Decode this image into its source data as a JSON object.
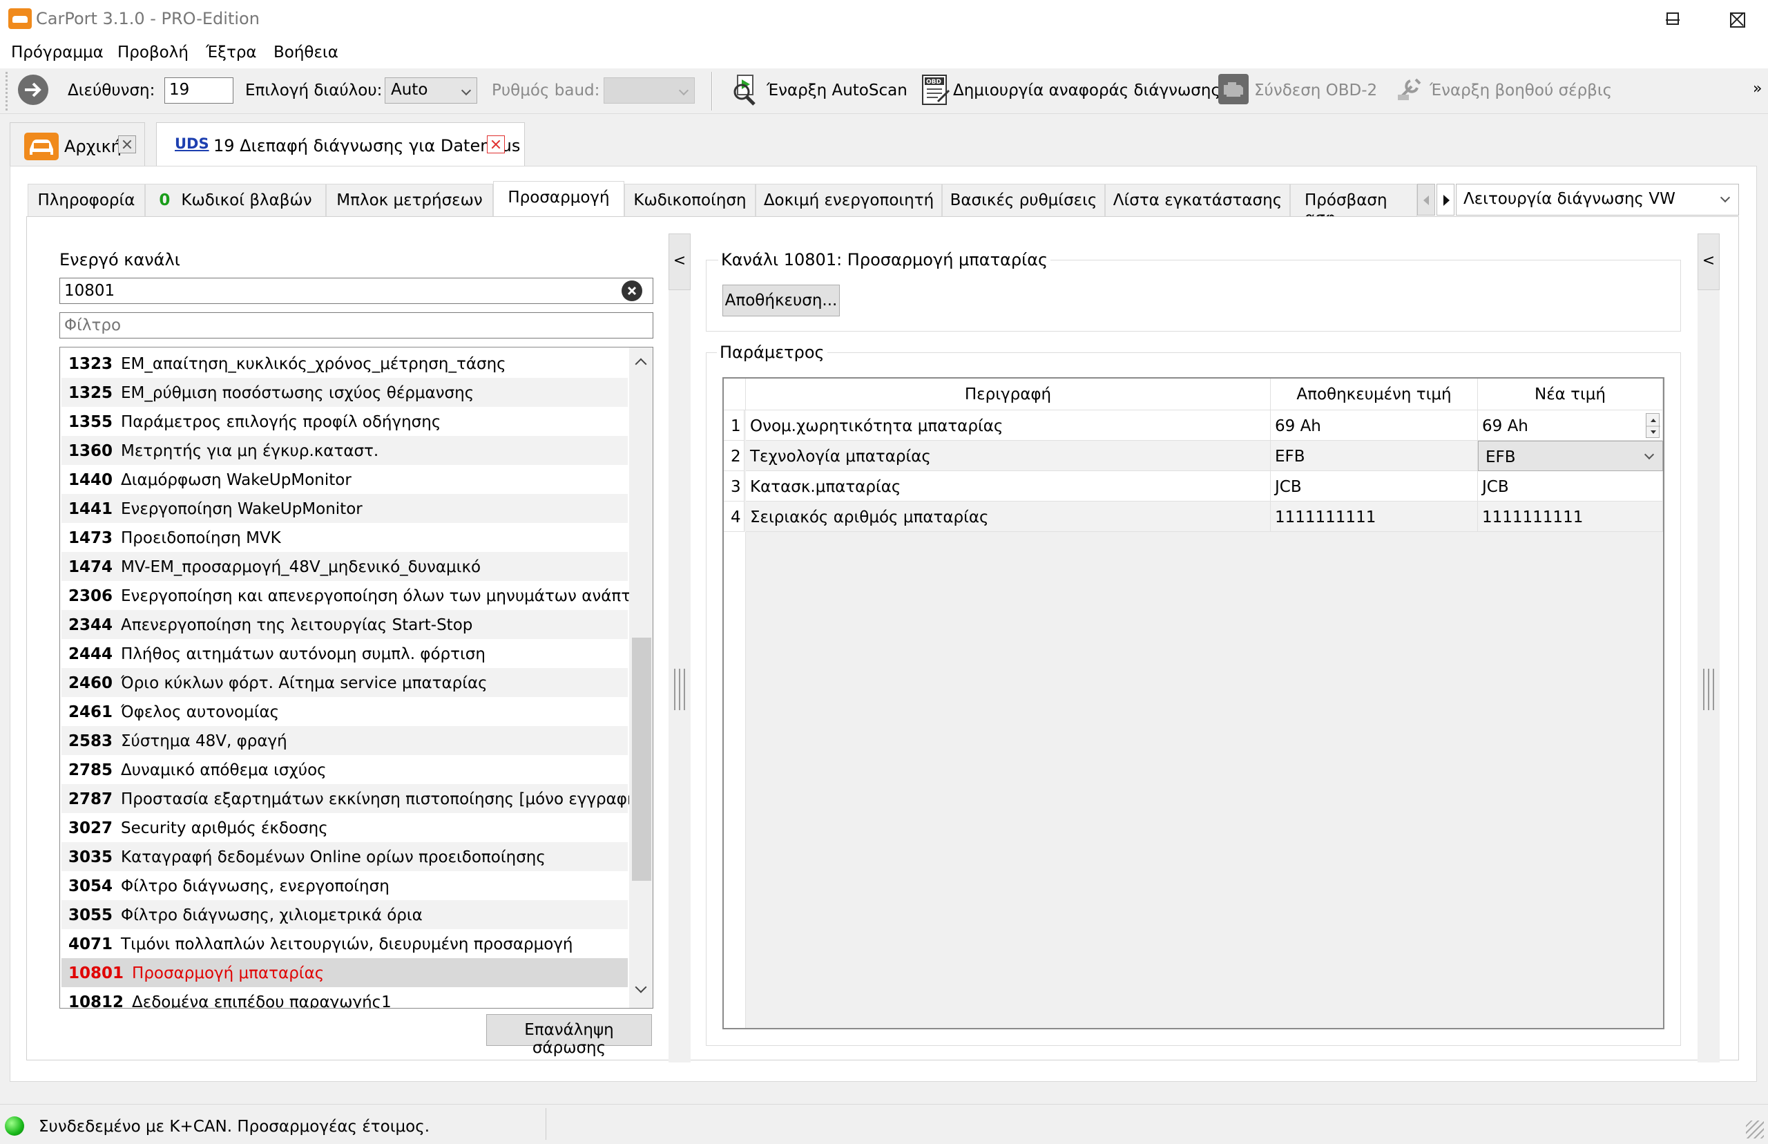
{
  "window": {
    "title": "CarPort 3.1.0 - PRO-Edition"
  },
  "menu": [
    "Πρόγραμμα",
    "Προβολή",
    "Έξτρα",
    "Βοήθεια"
  ],
  "toolbar": {
    "address_label": "Διεύθυνση:",
    "address_value": "19",
    "channel_label": "Επιλογή διαύλου:",
    "channel_value": "Auto",
    "baud_label": "Ρυθμός baud:",
    "baud_value": "",
    "autoscan": "Έναρξη AutoScan",
    "report": "Δημιουργία αναφοράς διάγνωσης",
    "obd": "Σύνδεση OBD-2",
    "service": "Έναρξη βοηθού σέρβις",
    "overflow": "»"
  },
  "doc_tabs": [
    {
      "label": "Αρχική"
    },
    {
      "badge": "UDS",
      "label": "19 Διεπαφή διάγνωσης για Datenbus"
    }
  ],
  "sub_tabs": [
    {
      "label": "Πληροφορία"
    },
    {
      "count": "0",
      "label": "Κωδικοί βλαβών"
    },
    {
      "label": "Μπλοκ μετρήσεων"
    },
    {
      "label": "Προσαρμογή"
    },
    {
      "label": "Κωδικοποίηση"
    },
    {
      "label": "Δοκιμή ενεργοποιητή"
    },
    {
      "label": "Βασικές ρυθμίσεις"
    },
    {
      "label": "Λίστα εγκατάστασης"
    },
    {
      "label": "Πρόσβαση ασφ"
    }
  ],
  "diag_mode": "Λειτουργία διάγνωσης VW",
  "left": {
    "active_channel_label": "Ενεργό κανάλι",
    "active_channel_value": "10801",
    "filter_placeholder": "Φίλτρο",
    "rescan_button": "Επανάληψη σάρωσης",
    "channels": [
      {
        "num": "1323",
        "name": "EM_απαίτηση_κυκλικός_χρόνος_μέτρηση_τάσης"
      },
      {
        "num": "1325",
        "name": "EM_ρύθμιση ποσόστωσης ισχύος θέρμανσης"
      },
      {
        "num": "1355",
        "name": "Παράμετρος επιλογής προφίλ οδήγησης"
      },
      {
        "num": "1360",
        "name": "Μετρητής για μη έγκυρ.καταστ."
      },
      {
        "num": "1440",
        "name": "Διαμόρφωση WakeUpMonitor"
      },
      {
        "num": "1441",
        "name": "Ενεργοποίηση WakeUpMonitor"
      },
      {
        "num": "1473",
        "name": "Προειδοποίηση MVK"
      },
      {
        "num": "1474",
        "name": "MV-EM_προσαρμογή_48V_μηδενικό_δυναμικό"
      },
      {
        "num": "2306",
        "name": "Ενεργοποίηση και απενεργοποίηση όλων των μηνυμάτων ανάπτυξης"
      },
      {
        "num": "2344",
        "name": "Απενεργοποίηση της λειτουργίας Start-Stop"
      },
      {
        "num": "2444",
        "name": "Πλήθος αιτημάτων αυτόνομη συμπλ. φόρτιση"
      },
      {
        "num": "2460",
        "name": "Όριο κύκλων φόρτ. Αίτημα service μπαταρίας"
      },
      {
        "num": "2461",
        "name": "Όφελος αυτονομίας"
      },
      {
        "num": "2583",
        "name": "Σύστημα 48V, φραγή"
      },
      {
        "num": "2785",
        "name": "Δυναμικό απόθεμα ισχύος"
      },
      {
        "num": "2787",
        "name": "Προστασία εξαρτημάτων εκκίνηση πιστοποίησης [μόνο εγγραφή]"
      },
      {
        "num": "3027",
        "name": "Security αριθμός έκδοσης"
      },
      {
        "num": "3035",
        "name": "Καταγραφή δεδομένων Online ορίων προειδοποίησης"
      },
      {
        "num": "3054",
        "name": "Φίλτρο διάγνωσης, ενεργοποίηση"
      },
      {
        "num": "3055",
        "name": "Φίλτρο διάγνωσης, χιλιομετρικά όρια"
      },
      {
        "num": "4071",
        "name": "Τιμόνι πολλαπλών λειτουργιών, διευρυμένη προσαρμογή"
      },
      {
        "num": "10801",
        "name": "Προσαρμογή μπαταρίας"
      },
      {
        "num": "10812",
        "name": "Δεδομένα επιπέδου παραγωγής1"
      }
    ]
  },
  "right": {
    "channel_group_title": "Κανάλι 10801: Προσαρμογή μπαταρίας",
    "save_button": "Αποθήκευση...",
    "param_group_title": "Παράμετρος",
    "columns": [
      "Περιγραφή",
      "Αποθηκευμένη τιμή",
      "Νέα τιμή"
    ],
    "rows": [
      {
        "n": "1",
        "desc": "Ονομ.χωρητικότητα μπαταρίας",
        "stored": "69 Ah",
        "new": "69 Ah"
      },
      {
        "n": "2",
        "desc": "Τεχνολογία μπαταρίας",
        "stored": "EFB",
        "new": "EFB"
      },
      {
        "n": "3",
        "desc": "Κατασκ.μπαταρίας",
        "stored": "JCB",
        "new": "JCB"
      },
      {
        "n": "4",
        "desc": "Σειριακός αριθμός μπαταρίας",
        "stored": "1111111111",
        "new": "1111111111"
      }
    ]
  },
  "collapse_glyph": "<",
  "status": "Συνδεδεμένο με K+CAN. Προσαρμογέας έτοιμος."
}
